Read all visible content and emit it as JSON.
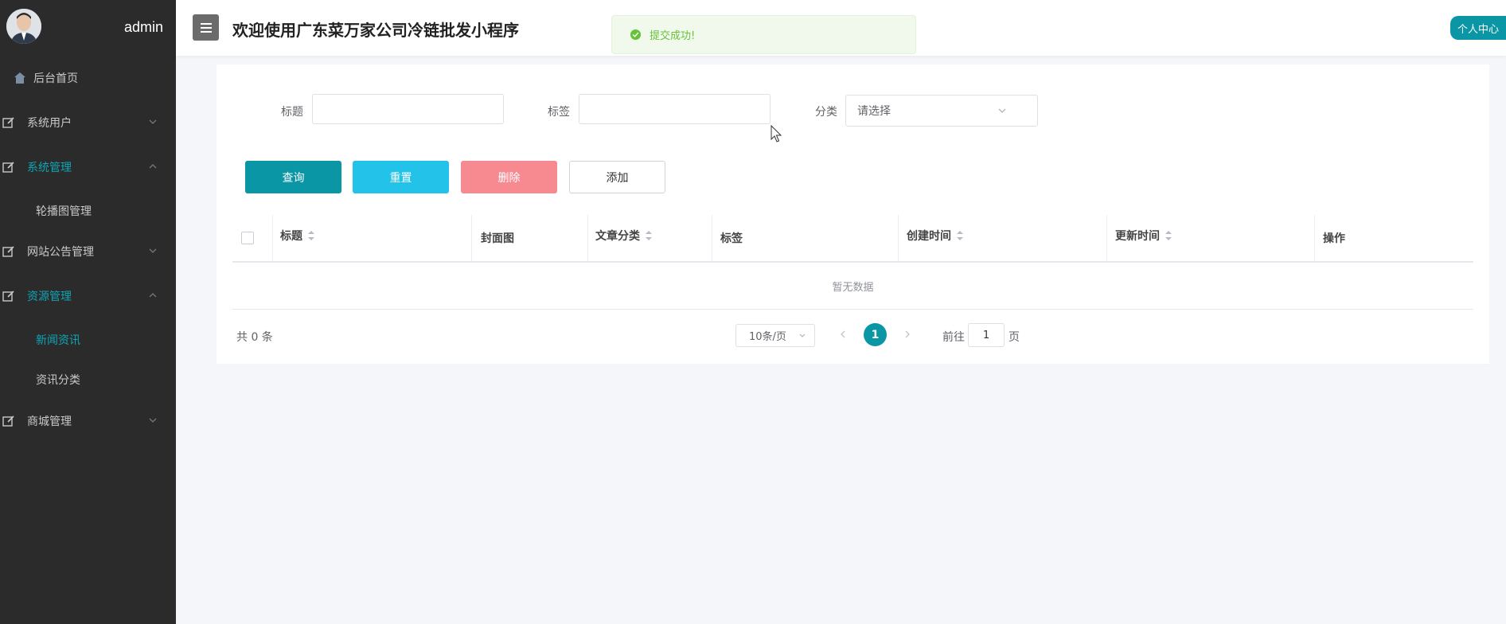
{
  "sidebar": {
    "admin_name": "admin",
    "items": [
      {
        "label": "后台首页",
        "icon": "home-icon"
      },
      {
        "label": "系统用户",
        "icon": "edit-icon",
        "expanded": false
      },
      {
        "label": "系统管理",
        "icon": "edit-icon",
        "expanded": true
      },
      {
        "label": "网站公告管理",
        "icon": "edit-icon",
        "expanded": false
      },
      {
        "label": "资源管理",
        "icon": "edit-icon",
        "expanded": true
      },
      {
        "label": "商城管理",
        "icon": "edit-icon",
        "expanded": false
      }
    ],
    "subitems": {
      "system": [
        "轮播图管理"
      ],
      "resources": [
        "新闻资讯",
        "资讯分类"
      ]
    },
    "active_color": "#0ea5b7"
  },
  "header": {
    "title": "欢迎使用广东菜万家公司冷链批发小程序",
    "personal_center": "个人中心"
  },
  "toast": {
    "message": "提交成功!",
    "color": "#67c23a"
  },
  "search": {
    "title_label": "标题",
    "title_value": "",
    "tag_label": "标签",
    "tag_value": "",
    "category_label": "分类",
    "category_placeholder": "请选择"
  },
  "buttons": {
    "query": "查询",
    "reset": "重置",
    "delete": "删除",
    "add": "添加"
  },
  "table": {
    "columns": [
      "标题",
      "封面图",
      "文章分类",
      "标签",
      "创建时间",
      "更新时间",
      "操作"
    ],
    "empty_text": "暂无数据"
  },
  "pagination": {
    "total": "共 0 条",
    "page_size": "10条/页",
    "current_page": "1",
    "goto_label": "前往",
    "goto_value": "1",
    "page_suffix": "页"
  },
  "colors": {
    "primary": "#0b96a6",
    "reset": "#23c2e8",
    "delete": "#f78a91",
    "sidebar_bg": "#2b2b2b"
  }
}
